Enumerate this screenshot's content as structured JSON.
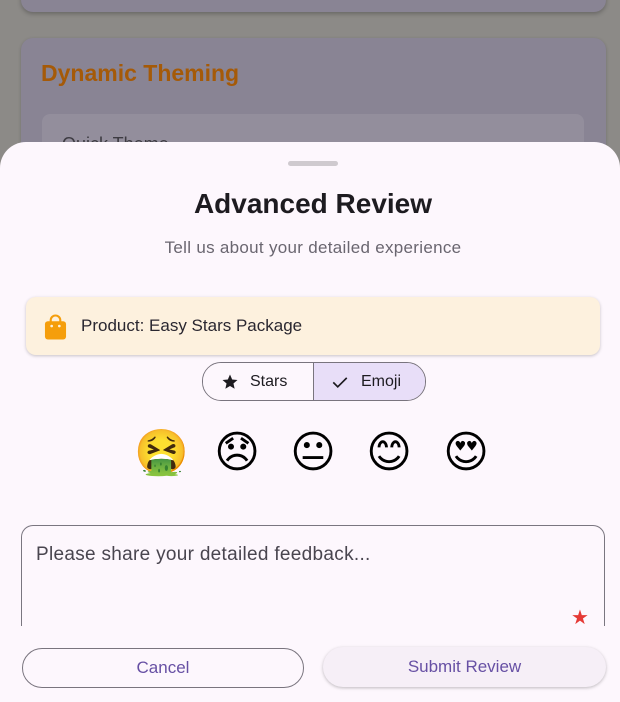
{
  "background": {
    "section_title": "Dynamic Theming",
    "inner_label": "Quick Theme"
  },
  "sheet": {
    "title": "Advanced Review",
    "subtitle": "Tell us about your detailed experience",
    "product": {
      "label": "Product: Easy Stars Package",
      "icon": "shopping-bag-icon"
    },
    "rating_mode": {
      "options": [
        {
          "label": "Stars",
          "icon": "star-icon",
          "selected": false
        },
        {
          "label": "Emoji",
          "icon": "check-icon",
          "selected": true
        }
      ]
    },
    "emojis": [
      {
        "glyph": "🤮",
        "name": "nauseated-emoji"
      },
      {
        "glyph": "😞",
        "name": "disappointed-emoji"
      },
      {
        "glyph": "😐",
        "name": "neutral-emoji"
      },
      {
        "glyph": "😊",
        "name": "smiling-emoji"
      },
      {
        "glyph": "😍",
        "name": "heart-eyes-emoji"
      }
    ],
    "feedback": {
      "placeholder": "Please share your detailed feedback...",
      "required_marker": "★"
    },
    "actions": {
      "cancel_label": "Cancel",
      "submit_label": "Submit Review"
    }
  },
  "colors": {
    "primary": "#6750a4",
    "accent_orange": "#f59e0b",
    "required_red": "#e53935",
    "selected_segment": "#e8def8",
    "product_card_bg": "#fdf1de"
  }
}
